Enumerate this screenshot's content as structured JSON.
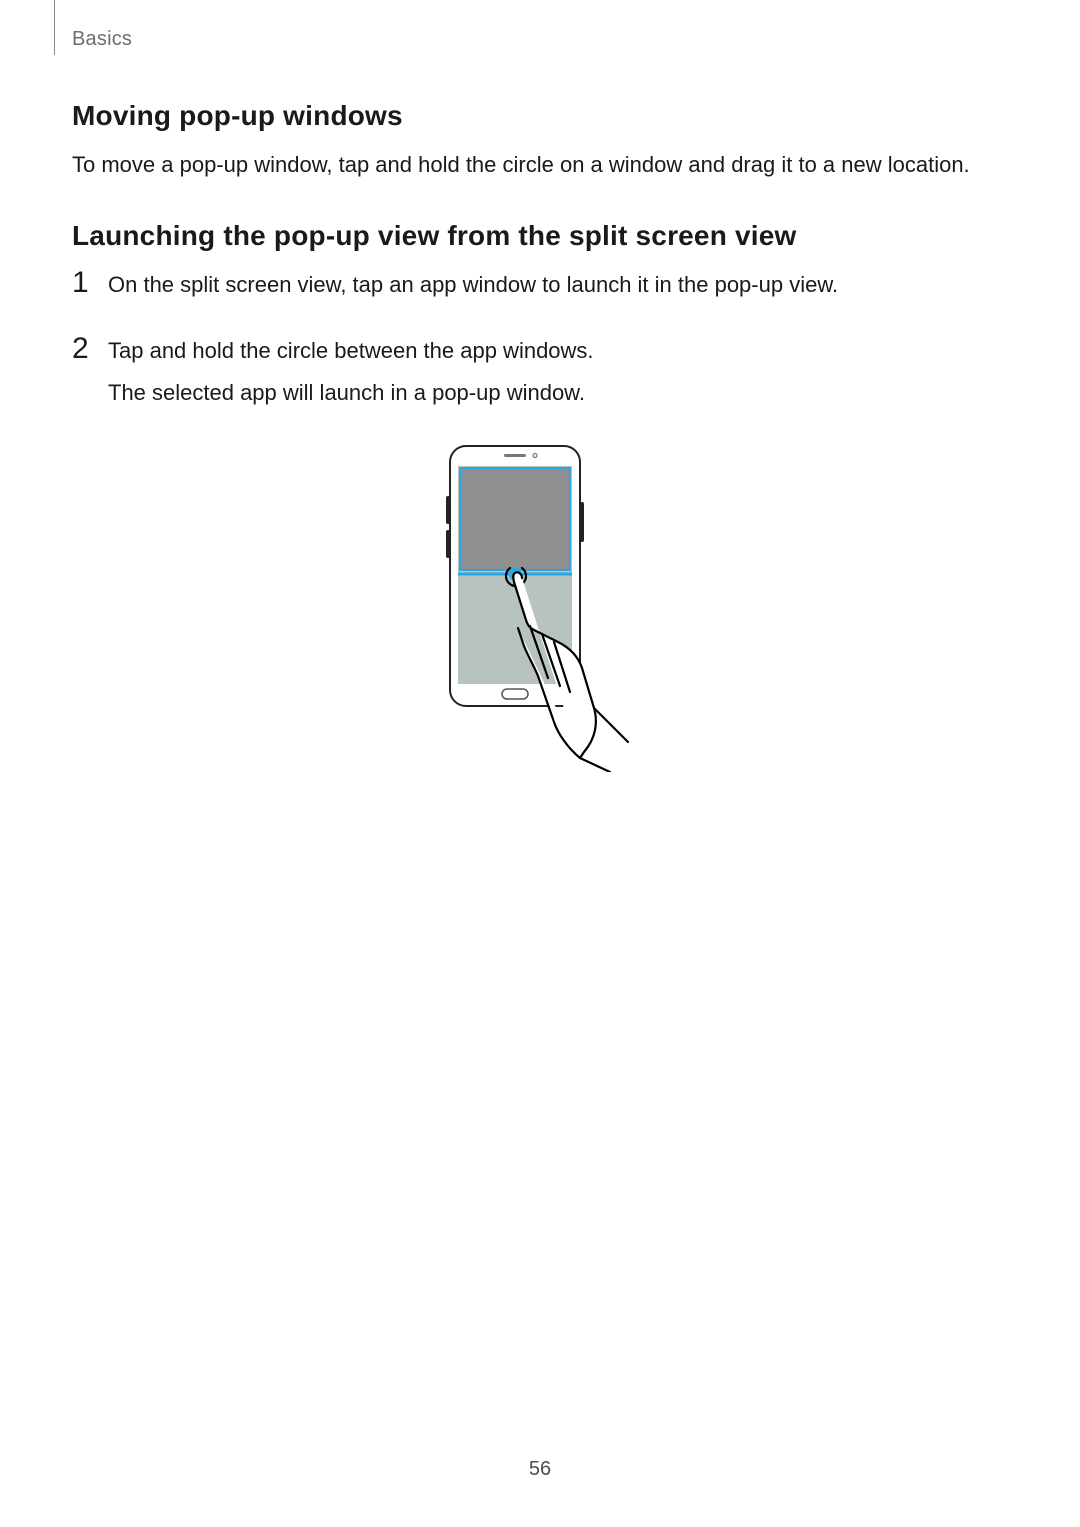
{
  "breadcrumb": "Basics",
  "section1": {
    "heading": "Moving pop-up windows",
    "paragraph": "To move a pop-up window, tap and hold the circle on a window and drag it to a new location."
  },
  "section2": {
    "heading": "Launching the pop-up view from the split screen view",
    "steps": [
      {
        "num": "1",
        "lines": [
          "On the split screen view, tap an app window to launch it in the pop-up view."
        ]
      },
      {
        "num": "2",
        "lines": [
          "Tap and hold the circle between the app windows.",
          "The selected app will launch in a pop-up window."
        ]
      }
    ]
  },
  "page_number": "56"
}
